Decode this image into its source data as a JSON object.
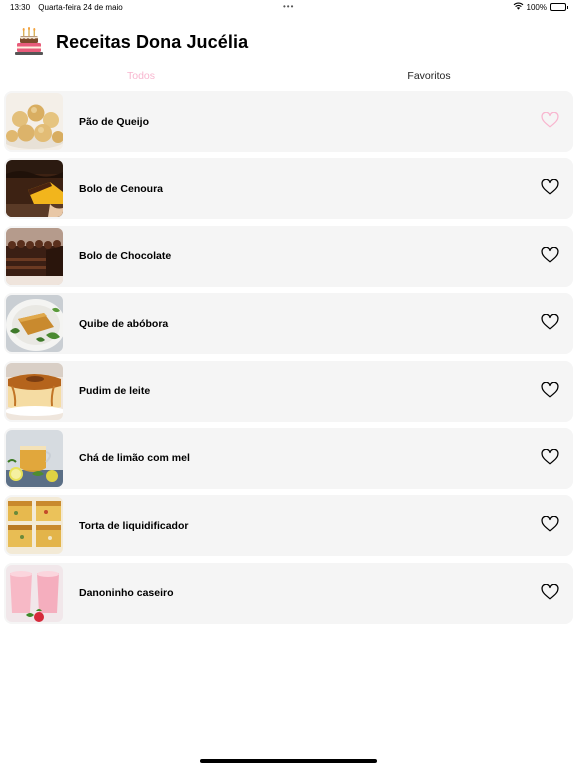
{
  "status_bar": {
    "time": "13:30",
    "date": "Quarta-feira 24 de maio",
    "dots": "•••",
    "battery": "100%",
    "icons": [
      "wifi-icon",
      "battery-icon"
    ]
  },
  "header": {
    "title": "Receitas Dona Jucélia",
    "logo_icon": "cake-icon"
  },
  "tabs": [
    {
      "label": "Todos",
      "selected": true
    },
    {
      "label": "Favoritos",
      "selected": false
    }
  ],
  "colors": {
    "accent_pink": "#f8b6cf",
    "row_background": "#f5f5f5",
    "text": "#000000"
  },
  "recipes": [
    {
      "name": "Pão de Queijo",
      "favorite_icon": "heart-outline-pink-icon",
      "image": "pao-de-queijo-photo"
    },
    {
      "name": "Bolo de Cenoura",
      "favorite_icon": "heart-outline-icon",
      "image": "bolo-de-cenoura-photo"
    },
    {
      "name": "Bolo de Chocolate",
      "favorite_icon": "heart-outline-icon",
      "image": "bolo-de-chocolate-photo"
    },
    {
      "name": "Quibe de abóbora",
      "favorite_icon": "heart-outline-icon",
      "image": "quibe-de-abobora-photo"
    },
    {
      "name": "Pudim de leite",
      "favorite_icon": "heart-outline-icon",
      "image": "pudim-de-leite-photo"
    },
    {
      "name": "Chá de limão com mel",
      "favorite_icon": "heart-outline-icon",
      "image": "cha-de-limao-photo"
    },
    {
      "name": "Torta de liquidificador",
      "favorite_icon": "heart-outline-icon",
      "image": "torta-de-liquidificador-photo"
    },
    {
      "name": "Danoninho caseiro",
      "favorite_icon": "heart-outline-icon",
      "image": "danoninho-caseiro-photo"
    }
  ]
}
